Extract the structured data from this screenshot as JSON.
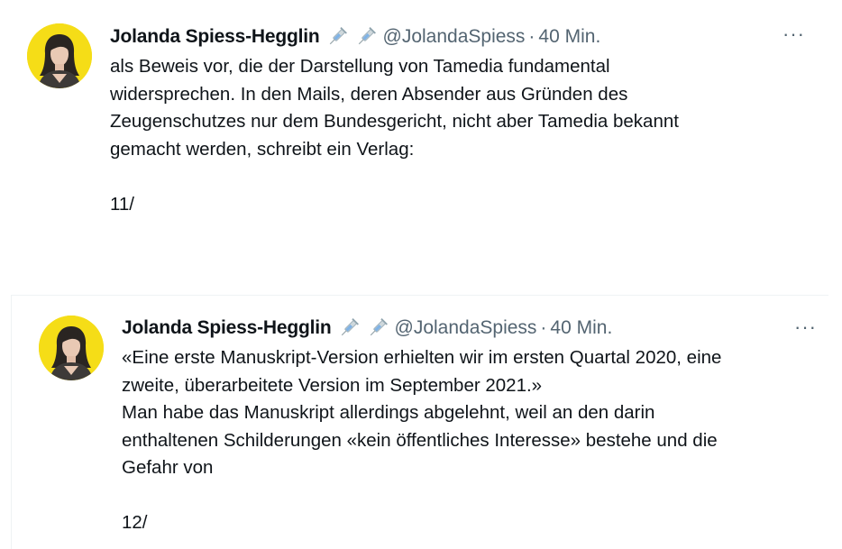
{
  "tweets": [
    {
      "author_name": "Jolanda Spiess-Hegglin",
      "emoji": [
        "syringe-icon",
        "syringe-icon"
      ],
      "handle": "@JolandaSpiess",
      "separator": "·",
      "time": "40 Min.",
      "more": "···",
      "lines": [
        "als Beweis vor, die der Darstellung von Tamedia fundamental",
        "widersprechen. In den Mails, deren Absender aus Gründen des",
        "Zeugenschutzes nur dem Bundesgericht, nicht aber Tamedia bekannt",
        "gemacht werden, schreibt ein Verlag:"
      ],
      "counter": "11/"
    },
    {
      "author_name": "Jolanda Spiess-Hegglin",
      "emoji": [
        "syringe-icon",
        "syringe-icon"
      ],
      "handle": "@JolandaSpiess",
      "separator": "·",
      "time": "40 Min.",
      "more": "···",
      "lines": [
        "«Eine erste Manuskript-Version erhielten wir im ersten Quartal 2020, eine",
        "zweite, überarbeitete Version im September 2021.»",
        "Man habe das Manuskript allerdings abgelehnt, weil an den darin",
        "enthaltenen Schilderungen «kein öffentliches Interesse» bestehe und die",
        "Gefahr von"
      ],
      "counter": "12/"
    }
  ],
  "colors": {
    "text": "#0f1419",
    "secondary": "#536471",
    "avatar_bg": "#f5dd17",
    "divider": "#eff3f4"
  }
}
